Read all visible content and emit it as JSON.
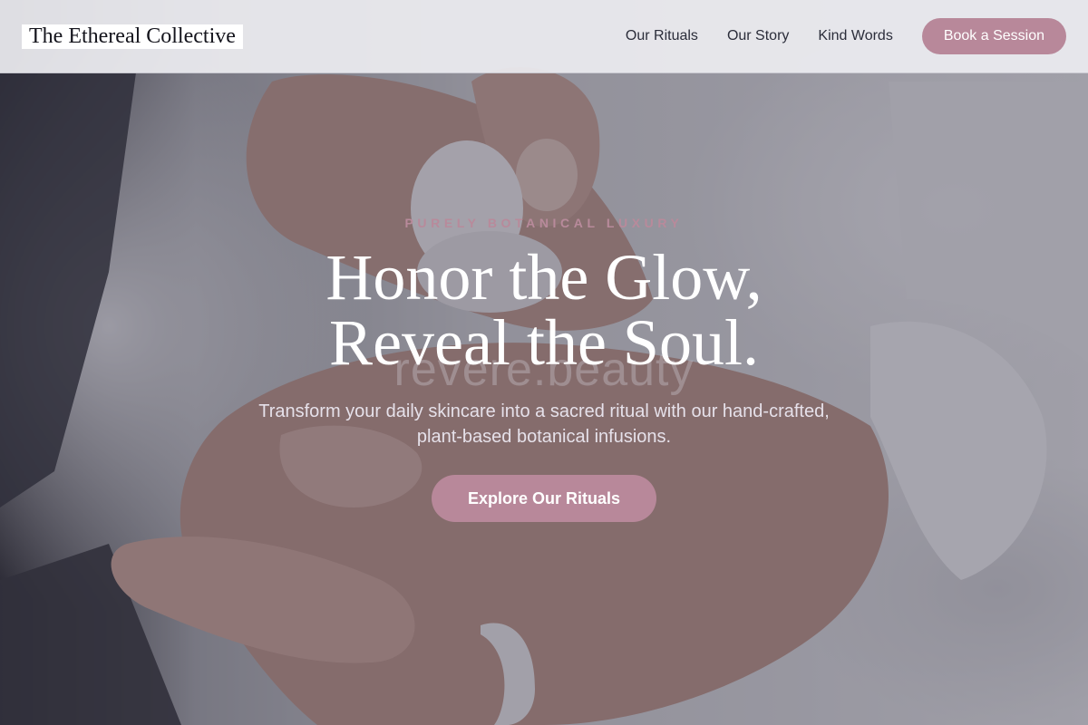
{
  "header": {
    "logo": "The Ethereal Collective",
    "nav": [
      "Our Rituals",
      "Our Story",
      "Kind Words"
    ],
    "cta": "Book a Session"
  },
  "hero": {
    "eyebrow": "PURELY BOTANICAL LUXURY",
    "headline_line1": "Honor the Glow,",
    "headline_line2": "Reveal the Soul.",
    "subtext": "Transform your daily skincare into a sacred ritual with our hand-crafted, plant-based botanical infusions.",
    "cta": "Explore Our Rituals",
    "background_text": "revere.beauty"
  },
  "colors": {
    "accent": "#b8889a",
    "eyebrow": "#b88a9b",
    "header_bg": "#ececf0",
    "text_dark": "#2b2d3a"
  }
}
